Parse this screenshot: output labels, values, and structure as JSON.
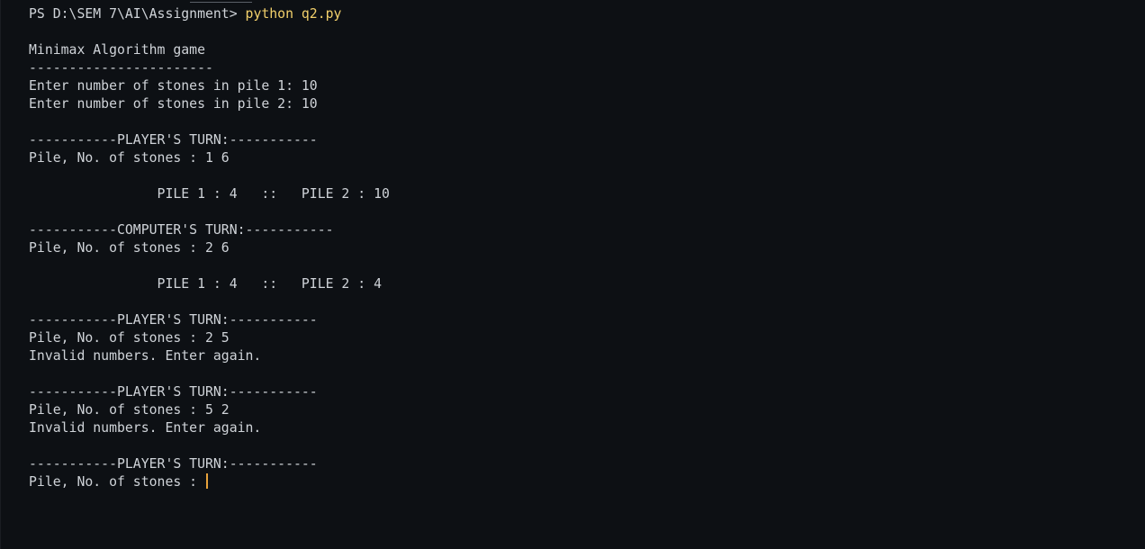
{
  "terminal": {
    "prompt": "PS D:\\SEM 7\\AI\\Assignment> ",
    "command": "python q2.py",
    "lines": [
      "",
      "Minimax Algorithm game",
      "-----------------------",
      "Enter number of stones in pile 1: 10",
      "Enter number of stones in pile 2: 10",
      "",
      "-----------PLAYER'S TURN:-----------",
      "Pile, No. of stones : 1 6",
      "",
      "                PILE 1 : 4   ::   PILE 2 : 10",
      "",
      "-----------COMPUTER'S TURN:-----------",
      "Pile, No. of stones : 2 6",
      "",
      "                PILE 1 : 4   ::   PILE 2 : 4",
      "",
      "-----------PLAYER'S TURN:-----------",
      "Pile, No. of stones : 2 5",
      "Invalid numbers. Enter again.",
      "",
      "-----------PLAYER'S TURN:-----------",
      "Pile, No. of stones : 5 2",
      "Invalid numbers. Enter again.",
      "",
      "-----------PLAYER'S TURN:-----------"
    ],
    "input_prompt": "Pile, No. of stones : ",
    "input_value": ""
  }
}
